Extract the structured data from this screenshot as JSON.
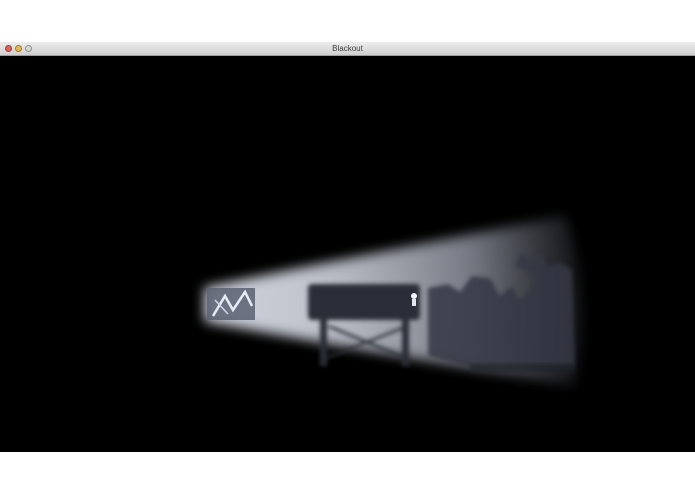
{
  "window": {
    "title": "Blackout"
  },
  "icons": {
    "close": "close-button",
    "minimize": "minimize-button",
    "zoom": "zoom-button"
  },
  "colors": {
    "titlebar_top": "#ededed",
    "titlebar_bottom": "#cfcfcf",
    "scene_background": "#000000",
    "light_beam": "#b9c1d2",
    "silhouette": "#2a2d36"
  }
}
